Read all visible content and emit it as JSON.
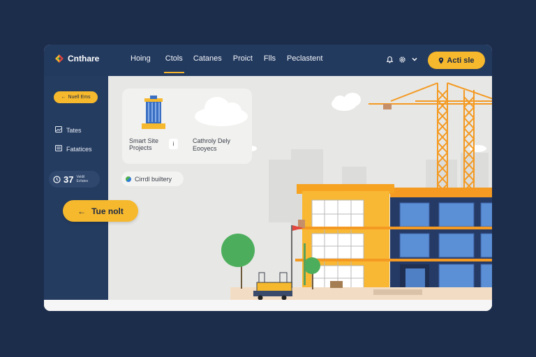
{
  "app": {
    "name": "Cnthare"
  },
  "nav": {
    "items": [
      {
        "label": "Hoing"
      },
      {
        "label": "Ctols"
      },
      {
        "label": "Catanes"
      },
      {
        "label": "Proict"
      },
      {
        "label": "Flls"
      },
      {
        "label": "Peclastent"
      }
    ],
    "active_index": 1
  },
  "toolbar": {
    "cta_label": "Acti sle",
    "cta_icon": "pin-icon"
  },
  "sidebar": {
    "pill_label": "Nuell Ems",
    "items": [
      {
        "icon": "image-icon",
        "label": "Tates"
      },
      {
        "icon": "list-icon",
        "label": "Fatatices"
      }
    ],
    "stat": {
      "value": "37",
      "label": "Veldil Ecfates"
    },
    "next_label": "Tue nolt"
  },
  "main": {
    "card": {
      "left_text": "Smart Site Projects",
      "separator": "i",
      "right_text": "Cathroly Dely Eooyecs"
    },
    "chip_label": "Cirrdl builtery"
  },
  "colors": {
    "background": "#1c2d4b",
    "topbar": "#233a5f",
    "sidebar": "#253c61",
    "accent": "#f6b82c",
    "crane": "#f59b2e"
  }
}
